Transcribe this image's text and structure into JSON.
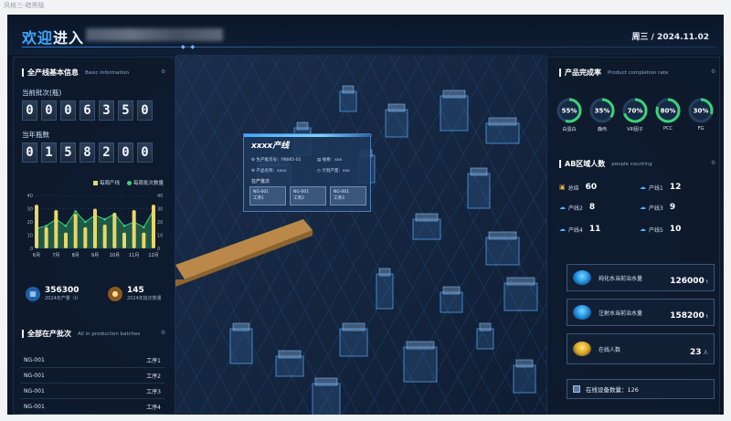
{
  "caption": "风格三-暗黑版",
  "header": {
    "title_accent": "欢迎",
    "title_rest": "进入",
    "date": "周三  /  2024.11.02"
  },
  "left": {
    "basic_info": {
      "title": "全产线基本信息",
      "subtitle": "Basic information"
    },
    "current_batch_label": "当前批次(瓶)",
    "current_batch_digits": [
      "0",
      "0",
      "0",
      "6",
      "3",
      "5",
      "0"
    ],
    "annual_bottles_label": "当年瓶数",
    "annual_bottles_digits": [
      "0",
      "1",
      "5",
      "8",
      "2",
      "0",
      "0"
    ],
    "legend": [
      {
        "label": "每周产线",
        "color": "#e8d66a"
      },
      {
        "label": "每周批次数量",
        "color": "#3bd27a"
      }
    ],
    "stats": [
      {
        "value": "356300",
        "label": "2024年产量（t）",
        "icon": "factory-icon"
      },
      {
        "value": "145",
        "label": "2024年批次数量",
        "icon": "batch-icon"
      }
    ],
    "batches": {
      "title": "全部在产批次",
      "subtitle": "All in production batches",
      "rows": [
        {
          "name": "NG-001",
          "proc": "工序1"
        },
        {
          "name": "NG-001",
          "proc": "工序2"
        },
        {
          "name": "NG-001",
          "proc": "工序3"
        },
        {
          "name": "NG-001",
          "proc": "工序4"
        }
      ]
    }
  },
  "chart_data": {
    "type": "bar",
    "categories": [
      "6月",
      "7月",
      "8月",
      "9月",
      "10月",
      "11月",
      "12月"
    ],
    "ylim": [
      0,
      40
    ],
    "y_ticks": [
      "40",
      "30",
      "20",
      "10",
      "0"
    ],
    "y_right_ticks": [
      "40",
      "30",
      "20",
      "10",
      "0"
    ],
    "series": [
      {
        "name": "每周产线",
        "type": "bar",
        "color": "#e8d66a",
        "values": [
          33,
          16,
          29,
          12,
          26,
          16,
          30,
          18,
          27,
          12,
          29,
          12,
          33
        ]
      },
      {
        "name": "每周批次数量",
        "type": "area",
        "color": "#3bd27a",
        "values": [
          15,
          17,
          22,
          17,
          28,
          20,
          25,
          22,
          26,
          17,
          20,
          16,
          29
        ]
      }
    ]
  },
  "center": {
    "popup": {
      "title": "xxxx产线",
      "kv": [
        {
          "k": "生产批次号：",
          "v": "YN065-01"
        },
        {
          "k": "规格：",
          "v": "xxx"
        },
        {
          "k": "产品名称：",
          "v": "xxxx"
        },
        {
          "k": "计划产量：",
          "v": "xxx"
        }
      ],
      "section": "在产批次",
      "boxes": [
        {
          "l1": "NG-001",
          "l2": "工序1"
        },
        {
          "l1": "NG-001",
          "l2": "工序2"
        },
        {
          "l1": "NG-001",
          "l2": "工序3"
        }
      ]
    }
  },
  "right": {
    "completion": {
      "title": "产品完成率",
      "subtitle": "Product completion rate"
    },
    "rings": [
      {
        "pct": 55,
        "label": "55%",
        "name": "白蛋白",
        "color": "#3bd27a"
      },
      {
        "pct": 35,
        "label": "35%",
        "name": "静丙",
        "color": "#3bd27a"
      },
      {
        "pct": 70,
        "label": "70%",
        "name": "VIII因子",
        "color": "#3bd27a"
      },
      {
        "pct": 80,
        "label": "80%",
        "name": "PCC",
        "color": "#3bd27a"
      },
      {
        "pct": 30,
        "label": "30%",
        "name": "FG",
        "color": "#3bd27a"
      }
    ],
    "people": {
      "title": "AB区域人数",
      "subtitle": "people counting",
      "cells": [
        {
          "label": "总结",
          "value": "60"
        },
        {
          "label": "产线1",
          "value": "12"
        },
        {
          "label": "产线2",
          "value": "8"
        },
        {
          "label": "产线3",
          "value": "9"
        },
        {
          "label": "产线4",
          "value": "11"
        },
        {
          "label": "产线5",
          "value": "10"
        }
      ]
    },
    "cards": [
      {
        "label": "纯化水当前治水量",
        "value": "126000",
        "unit": "t"
      },
      {
        "label": "注射水当前治水量",
        "value": "158200",
        "unit": "t"
      },
      {
        "label": "在线人数",
        "value": "23",
        "unit": "人"
      }
    ],
    "device": "在线设备数量：126"
  }
}
